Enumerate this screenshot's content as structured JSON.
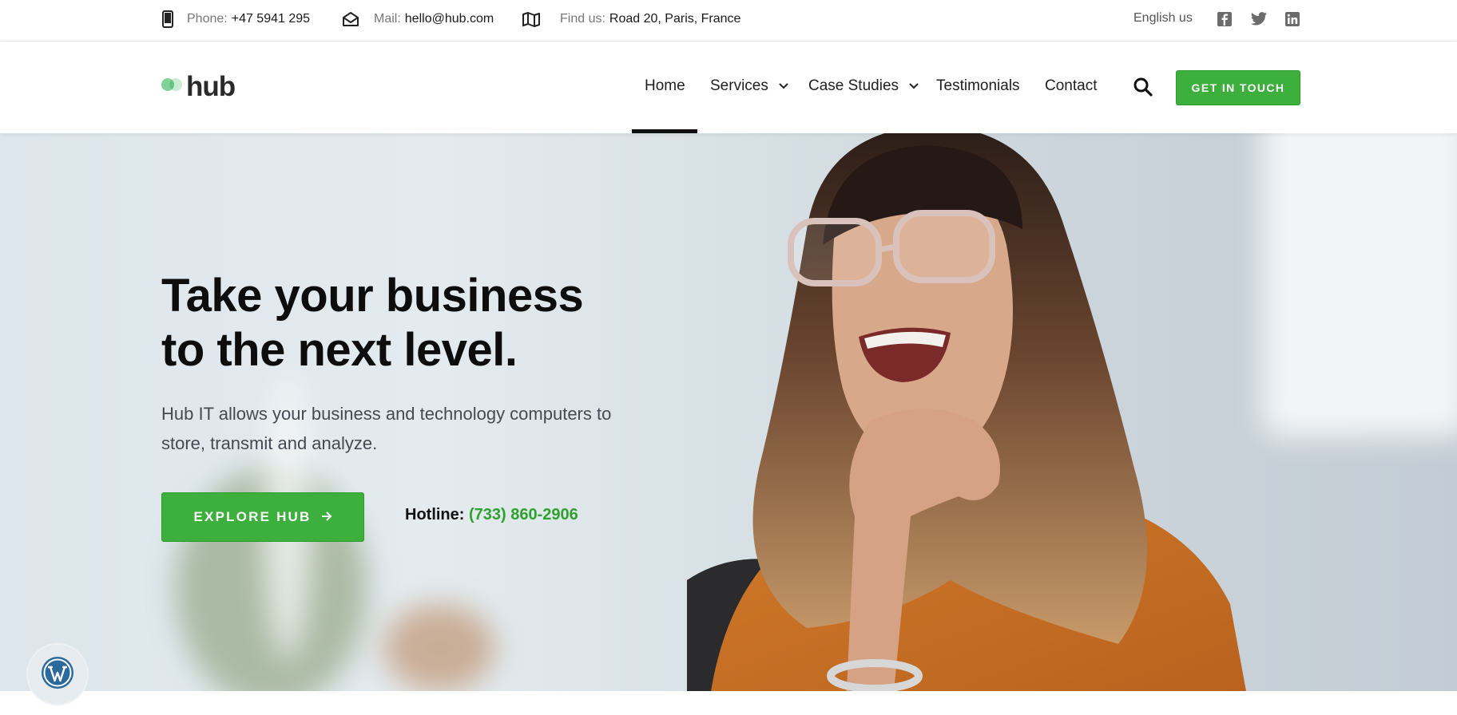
{
  "topbar": {
    "phone": {
      "label": "Phone:",
      "value": "+47 5941 295",
      "icon": "phone-icon"
    },
    "mail": {
      "label": "Mail:",
      "value": "hello@hub.com",
      "icon": "envelope-icon"
    },
    "location": {
      "label": "Find us:",
      "value": "Road 20, Paris, France",
      "icon": "map-icon"
    },
    "language": "English us",
    "social": [
      "facebook-icon",
      "twitter-icon",
      "linkedin-icon"
    ]
  },
  "header": {
    "logo_text": "hub",
    "nav": [
      {
        "label": "Home",
        "active": true,
        "dropdown": false
      },
      {
        "label": "Services",
        "active": false,
        "dropdown": true
      },
      {
        "label": "Case Studies",
        "active": false,
        "dropdown": true
      },
      {
        "label": "Testimonials",
        "active": false,
        "dropdown": false
      },
      {
        "label": "Contact",
        "active": false,
        "dropdown": false
      }
    ],
    "cta_label": "GET IN TOUCH"
  },
  "hero": {
    "title_line1": "Take your business",
    "title_line2": "to the next level.",
    "subtitle": "Hub IT allows your business and technology computers to store, transmit and analyze.",
    "button_label": "EXPLORE HUB",
    "hotline_label": "Hotline:",
    "hotline_number": "(733) 860-2906"
  },
  "colors": {
    "accent": "#3daf3c",
    "hotline": "#2ea12e",
    "text_dark": "#0d0d0d"
  }
}
